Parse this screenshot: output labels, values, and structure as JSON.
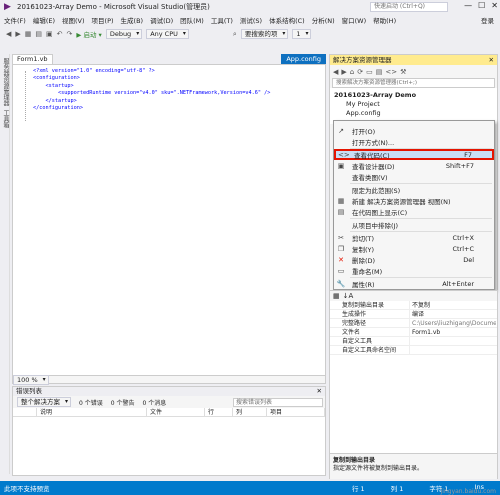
{
  "window": {
    "title": "20161023-Array Demo - Microsoft Visual Studio(管理员)",
    "quick_launch": "快速启动 (Ctrl+Q)",
    "minimize": "—",
    "maximize": "☐",
    "close": "✕"
  },
  "menu": {
    "items": [
      "文件(F)",
      "编辑(E)",
      "视图(V)",
      "项目(P)",
      "生成(B)",
      "调试(D)",
      "团队(M)",
      "工具(T)",
      "测试(S)",
      "体系结构(C)",
      "分析(N)",
      "窗口(W)",
      "帮助(H)"
    ],
    "login": "登录"
  },
  "toolbar": {
    "start": "▶ 启动 ▾",
    "config": "Debug",
    "platform": "Any CPU",
    "find_label": "要搜索的项",
    "page": "1"
  },
  "left_side_tabs": [
    "服务器资源管理器",
    "工具箱"
  ],
  "editor": {
    "tab_label": "Form1.vb",
    "active_tab": "App.config",
    "code_lines": [
      "<?xml version=\"1.0\" encoding=\"utf-8\" ?>",
      "<configuration>",
      "    <startup>",
      "        <supportedRuntime version=\"v4.0\" sku=\".NETFramework,Version=v4.6\" />",
      "    </startup>",
      "</configuration>"
    ],
    "zoom": "100 %"
  },
  "error_list": {
    "title": "错误列表",
    "filter": "整个解决方案",
    "errors": "0 个错误",
    "warnings": "0 个警告",
    "messages": "0 个消息",
    "search_placeholder": "搜索错误列表",
    "columns": [
      "说明",
      "文件",
      "行",
      "列",
      "项目"
    ]
  },
  "solution_explorer": {
    "title": "解决方案资源管理器",
    "search_placeholder": "搜索解决方案资源管理器(Ctrl+;)",
    "solution": "20161023-Array Demo",
    "project": "My Project",
    "file": "App.config"
  },
  "context_menu": {
    "items": [
      {
        "icon": "↗",
        "label": "打开(O)",
        "shortcut": ""
      },
      {
        "icon": "",
        "label": "打开方式(N)...",
        "shortcut": ""
      },
      {
        "icon": "<>",
        "label": "查看代码(C)",
        "shortcut": "F7"
      },
      {
        "icon": "▣",
        "label": "查看设计器(D)",
        "shortcut": "Shift+F7"
      },
      {
        "icon": "",
        "label": "查看类图(V)",
        "shortcut": ""
      },
      {
        "icon": "",
        "label": "限定为此范围(S)",
        "shortcut": ""
      },
      {
        "icon": "▦",
        "label": "新建 解决方案资源管理器 视图(N)",
        "shortcut": ""
      },
      {
        "icon": "▤",
        "label": "在代码图上显示(C)",
        "shortcut": ""
      },
      {
        "icon": "",
        "label": "从项目中排除(J)",
        "shortcut": ""
      },
      {
        "icon": "✂",
        "label": "剪切(T)",
        "shortcut": "Ctrl+X"
      },
      {
        "icon": "❐",
        "label": "复制(Y)",
        "shortcut": "Ctrl+C"
      },
      {
        "icon": "✕",
        "label": "删除(D)",
        "shortcut": "Del"
      },
      {
        "icon": "▭",
        "label": "重命名(M)",
        "shortcut": ""
      },
      {
        "icon": "🔧",
        "label": "属性(R)",
        "shortcut": "Alt+Enter"
      }
    ]
  },
  "properties": {
    "rows": [
      {
        "k": "复制到输出目录",
        "v": "不复制"
      },
      {
        "k": "生成操作",
        "v": "编译"
      },
      {
        "k": "完整路径",
        "v": "C:\\Users\\liuzhigang\\Documen"
      },
      {
        "k": "文件名",
        "v": "Form1.vb"
      },
      {
        "k": "自定义工具",
        "v": ""
      },
      {
        "k": "自定义工具命名空间",
        "v": ""
      }
    ],
    "desc_title": "复制到输出目录",
    "desc_text": "指定源文件将被复制到输出目录。"
  },
  "status": {
    "left": "此项不支持预览",
    "line": "行 1",
    "col": "列 1",
    "char": "字符 1",
    "mode": "Ins"
  },
  "watermark": "jingyan.baidu.com"
}
